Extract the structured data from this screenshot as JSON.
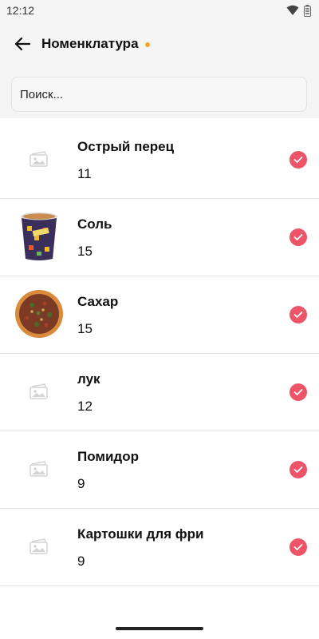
{
  "status": {
    "time": "12:12"
  },
  "header": {
    "title": "Номенклатура"
  },
  "search": {
    "placeholder": "Поиск..."
  },
  "items": [
    {
      "name": "Острый перец",
      "qty": "11",
      "image": "placeholder-icon",
      "checked": true
    },
    {
      "name": "Соль",
      "qty": "15",
      "image": "coffee-cup",
      "checked": true
    },
    {
      "name": "Сахар",
      "qty": "15",
      "image": "pizza",
      "checked": true
    },
    {
      "name": "лук",
      "qty": "12",
      "image": "placeholder-icon",
      "checked": true
    },
    {
      "name": "Помидор",
      "qty": "9",
      "image": "placeholder-icon",
      "checked": true
    },
    {
      "name": "Картошки для фри",
      "qty": "9",
      "image": "placeholder-icon",
      "checked": true
    }
  ],
  "colors": {
    "accent": "#ee5468",
    "unsaved_dot": "#f5a623",
    "background": "#f5f5f5"
  }
}
